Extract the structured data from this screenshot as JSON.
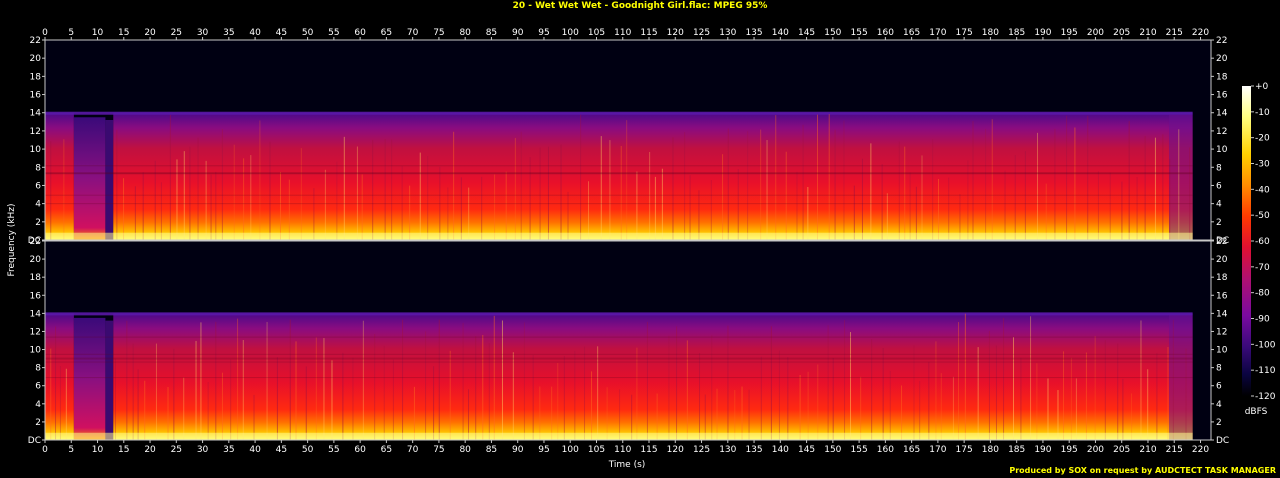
{
  "title": "20 - Wet Wet Wet - Goodnight Girl.flac: MPEG 95%",
  "credit": "Produced by SOX on request by AUDCTECT TASK MANAGER",
  "chart_data": {
    "type": "heatmap",
    "title": "20 - Wet Wet Wet - Goodnight Girl.flac: MPEG 95%",
    "xlabel": "Time (s)",
    "ylabel": "Frequency (kHz)",
    "x_ticks": [
      0,
      5,
      10,
      15,
      20,
      25,
      30,
      35,
      40,
      45,
      50,
      55,
      60,
      65,
      70,
      75,
      80,
      85,
      90,
      95,
      100,
      105,
      110,
      115,
      120,
      125,
      130,
      135,
      140,
      145,
      150,
      155,
      160,
      165,
      170,
      175,
      180,
      185,
      190,
      195,
      200,
      205,
      210,
      215,
      220
    ],
    "xlim": [
      0,
      222
    ],
    "y_ticks": [
      0,
      2,
      4,
      6,
      8,
      10,
      12,
      14,
      16,
      18,
      20,
      22
    ],
    "y_tick_labels_left": [
      "DC",
      "2",
      "4",
      "6",
      "8",
      "10",
      "12",
      "14",
      "16",
      "18",
      "20",
      "22"
    ],
    "y_tick_labels_right": [
      "DC",
      "2",
      "4",
      "6",
      "8",
      "10",
      "12",
      "14",
      "16",
      "18",
      "20",
      "22"
    ],
    "ylim": [
      0,
      22
    ],
    "channels": 2,
    "audio_end_s": 218.5,
    "lowpass_cutoff_khz": 14,
    "quiet_segments": [
      {
        "start_s": 5.5,
        "end_s": 11.5,
        "note": "reduced cutoff ~13.5 kHz"
      },
      {
        "start_s": 11.5,
        "end_s": 13.0,
        "note": "dip / near-silence"
      }
    ],
    "colorbar": {
      "label": "dBFS",
      "ticks": [
        "+0",
        "-10",
        "-20",
        "-30",
        "-40",
        "-50",
        "-60",
        "-70",
        "-80",
        "-90",
        "-100",
        "-110",
        "-120"
      ],
      "range": [
        -120,
        0
      ],
      "colors": [
        "#000000",
        "#0a0440",
        "#3a0a7a",
        "#7a0aa0",
        "#b01070",
        "#e01030",
        "#ff3a00",
        "#ff8c00",
        "#ffd000",
        "#ffff80",
        "#ffffff"
      ]
    }
  },
  "colors": {
    "background": "#000000",
    "plot_bg": "#000012",
    "axis": "#c8c8c8",
    "title": "#ffff00"
  }
}
